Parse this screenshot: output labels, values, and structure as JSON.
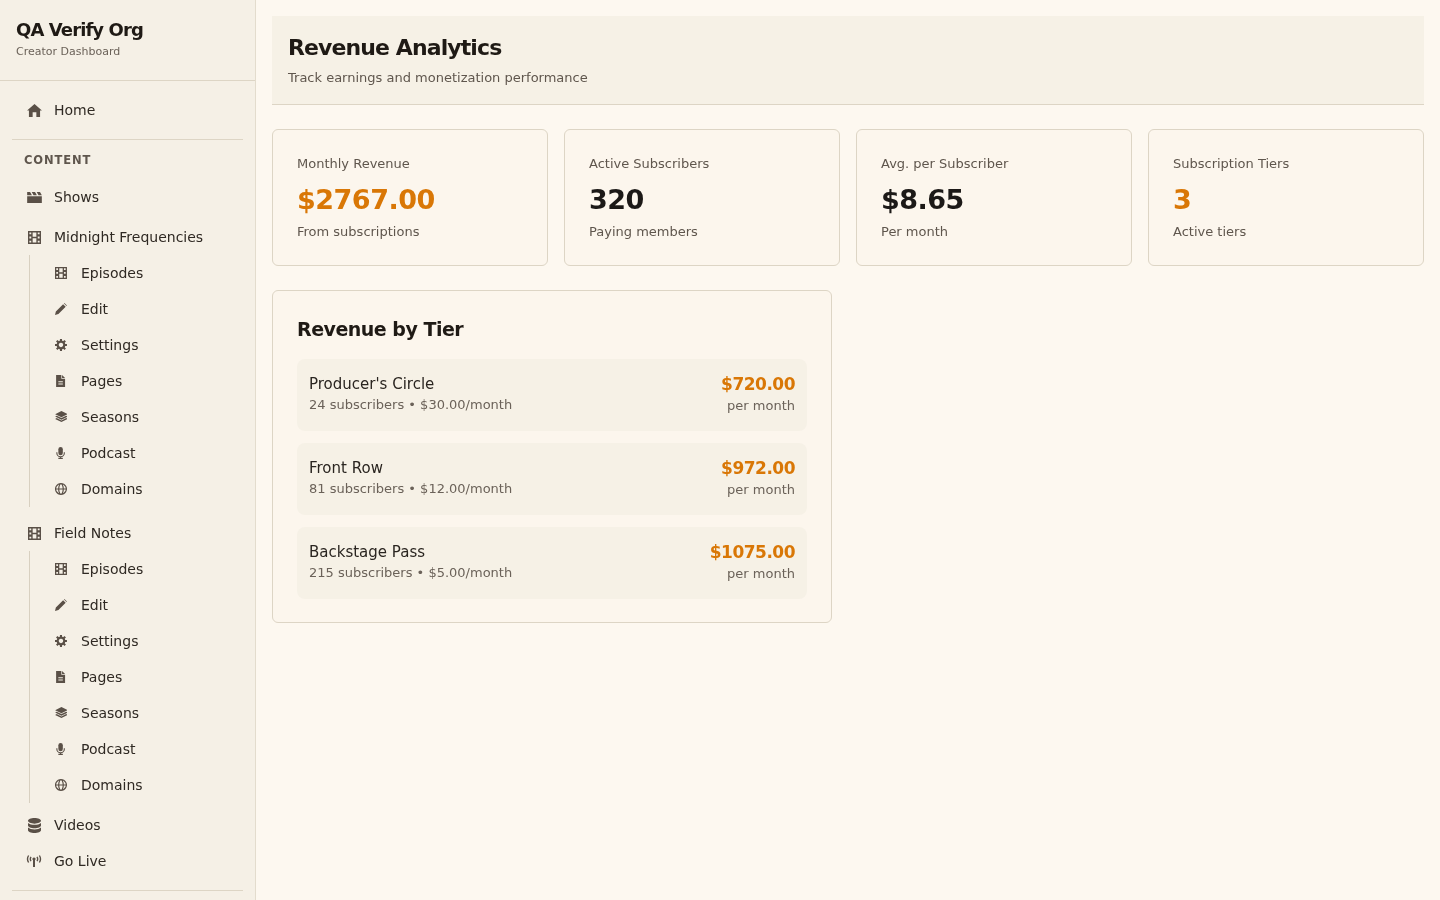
{
  "sidebar": {
    "org_name": "QA Verify Org",
    "subtitle": "Creator Dashboard",
    "top_items": [
      {
        "label": "Home",
        "selected": false
      }
    ],
    "sections": [
      {
        "heading": "CONTENT",
        "items": [
          {
            "label": "Shows",
            "selected": false
          },
          {
            "label": "Midnight Frequencies",
            "selected": false,
            "children": [
              {
                "label": "Episodes",
                "selected": false
              },
              {
                "label": "Edit",
                "selected": false
              },
              {
                "label": "Settings",
                "selected": false
              },
              {
                "label": "Pages",
                "selected": false
              },
              {
                "label": "Seasons",
                "selected": false
              },
              {
                "label": "Podcast",
                "selected": false
              },
              {
                "label": "Domains",
                "selected": false
              }
            ]
          },
          {
            "label": "Field Notes",
            "selected": false,
            "children": [
              {
                "label": "Episodes",
                "selected": false
              },
              {
                "label": "Edit",
                "selected": false
              },
              {
                "label": "Settings",
                "selected": false
              },
              {
                "label": "Pages",
                "selected": false
              },
              {
                "label": "Seasons",
                "selected": false
              },
              {
                "label": "Podcast",
                "selected": false
              },
              {
                "label": "Domains",
                "selected": false
              }
            ]
          },
          {
            "label": "Videos",
            "selected": false
          },
          {
            "label": "Go Live",
            "selected": false
          }
        ]
      }
    ]
  },
  "header": {
    "title": "Revenue Analytics",
    "subtitle": "Track earnings and monetization performance"
  },
  "stats": [
    {
      "label": "Monthly Revenue",
      "value": "$2767.00",
      "note": "From subscriptions",
      "color": "#d97706"
    },
    {
      "label": "Active Subscribers",
      "value": "320",
      "note": "Paying members",
      "color": "#1c1917"
    },
    {
      "label": "Avg. per Subscriber",
      "value": "$8.65",
      "note": "Per month",
      "color": "#1c1917"
    },
    {
      "label": "Subscription Tiers",
      "value": "3",
      "note": "Active tiers",
      "color": "#d97706"
    }
  ],
  "revenue_by_tier": {
    "title": "Revenue by Tier",
    "tiers": [
      {
        "name": "Producer's Circle",
        "details": "24 subscribers • $30.00/month",
        "amount": "$720.00",
        "period": "per month"
      },
      {
        "name": "Front Row",
        "details": "81 subscribers • $12.00/month",
        "amount": "$972.00",
        "period": "per month"
      },
      {
        "name": "Backstage Pass",
        "details": "215 subscribers • $5.00/month",
        "amount": "$1075.00",
        "period": "per month"
      }
    ]
  }
}
